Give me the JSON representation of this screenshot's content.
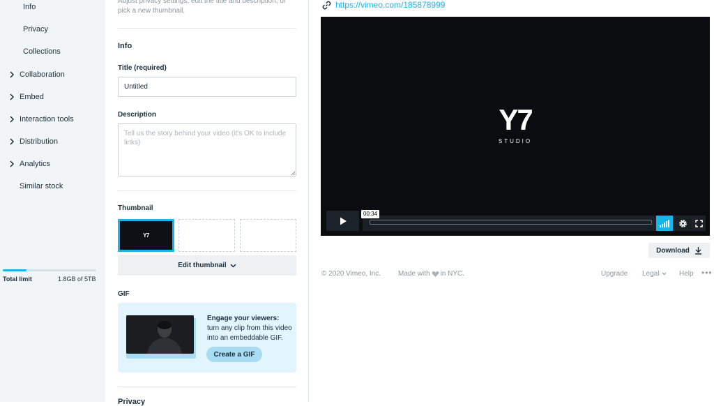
{
  "sidebar": {
    "sub_items": [
      {
        "label": "Info"
      },
      {
        "label": "Privacy"
      },
      {
        "label": "Collections"
      }
    ],
    "items": [
      {
        "label": "Collaboration",
        "icon": "chevron-right-icon"
      },
      {
        "label": "Embed",
        "icon": "chevron-right-icon"
      },
      {
        "label": "Interaction tools",
        "icon": "chevron-right-icon"
      },
      {
        "label": "Distribution",
        "icon": "chevron-right-icon"
      },
      {
        "label": "Analytics",
        "icon": "chevron-right-icon"
      },
      {
        "label": "Similar stock"
      }
    ],
    "storage": {
      "label": "Total limit",
      "value": "1.8GB of 5TB",
      "progress_fraction": 0.25,
      "bar_color": "#17b6e8"
    }
  },
  "main": {
    "intro": "Adjust privacy settings, edit the title and description, or pick a new thumbnail.",
    "info_section": {
      "title": "Info"
    },
    "title_field": {
      "label": "Title (required)",
      "value": "Untitled"
    },
    "description_field": {
      "label": "Description",
      "placeholder": "Tell us the story behind your video (it's OK to include  links)"
    },
    "thumbnail": {
      "label": "Thumbnail",
      "selected_thumb_text": "Y7",
      "edit_button": "Edit thumbnail",
      "selected_color": "#17b6e8"
    },
    "gif": {
      "label": "GIF",
      "text_bold": "Engage your viewers:",
      "text_rest": " turn any clip from this video into an embeddable GIF.",
      "button": "Create a GIF"
    },
    "privacy_peek": "Privacy"
  },
  "right": {
    "url": "https://vimeo.com/185878999",
    "player": {
      "logo_mark": "Y7",
      "logo_sub": "STUDIO",
      "timestamp": "00:34",
      "accent": "#17b6e8"
    },
    "download_button": "Download",
    "footer": {
      "copyright": "© 2020 Vimeo, Inc.",
      "made_with": "Made with",
      "made_in": "in NYC.",
      "upgrade": "Upgrade",
      "legal": "Legal",
      "help": "Help",
      "more": "•••"
    }
  }
}
